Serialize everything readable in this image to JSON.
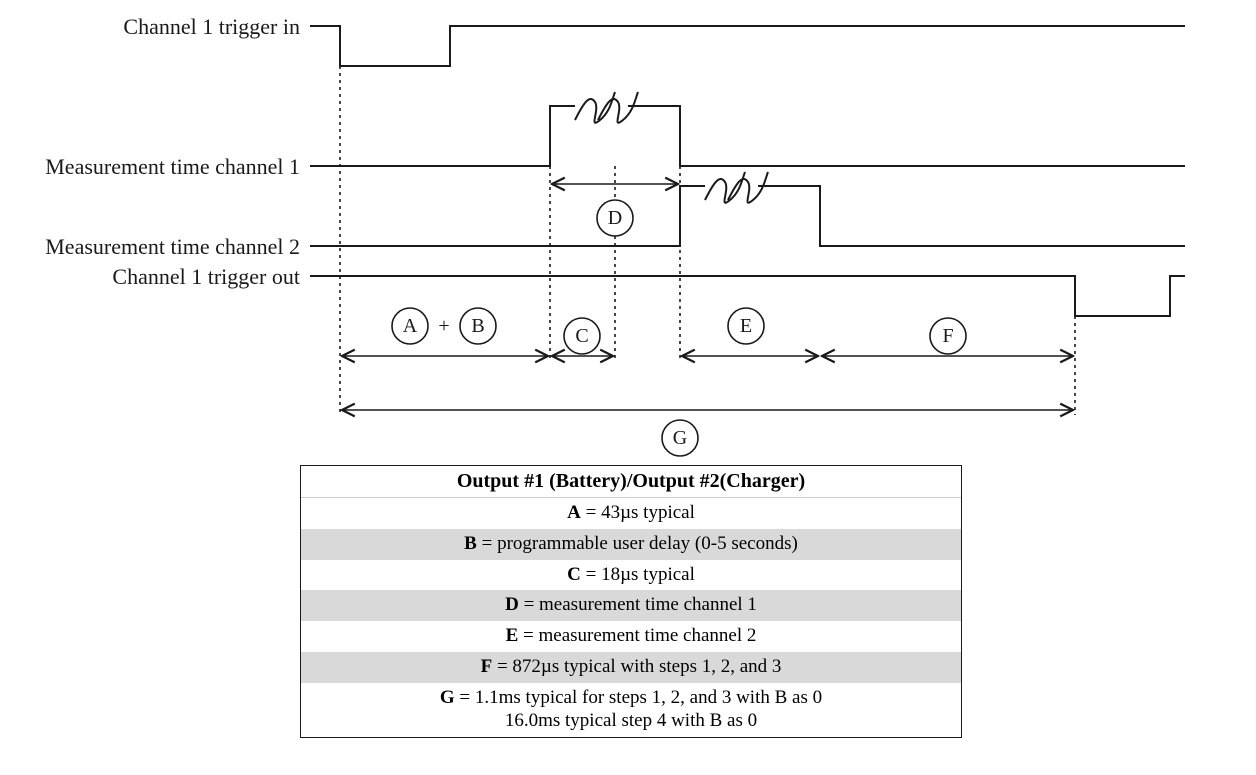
{
  "signals": {
    "trigger_in": {
      "label": "Channel 1 trigger in"
    },
    "meas_ch1": {
      "label": "Measurement time channel 1"
    },
    "meas_ch2": {
      "label": "Measurement time channel 2"
    },
    "trigger_out": {
      "label": "Channel 1 trigger out"
    }
  },
  "spans": {
    "AB_plus": "+",
    "A": "A",
    "B": "B",
    "C": "C",
    "D": "D",
    "E": "E",
    "F": "F",
    "G": "G"
  },
  "table": {
    "header": "Output #1 (Battery)/Output #2(Charger)",
    "rows": [
      {
        "key": "A",
        "text": " = 43µs typical",
        "shade": false
      },
      {
        "key": "B",
        "text": " = programmable user delay (0-5 seconds)",
        "shade": true
      },
      {
        "key": "C",
        "text": " = 18µs typical",
        "shade": false
      },
      {
        "key": "D",
        "text": " = measurement time channel 1",
        "shade": true
      },
      {
        "key": "E",
        "text": " = measurement time channel 2",
        "shade": false
      },
      {
        "key": "F",
        "text": " = 872µs typical with steps 1, 2, and 3",
        "shade": true
      },
      {
        "key": "G",
        "text": " = 1.1ms typical for steps 1, 2, and 3 with B as 0",
        "text2": "16.0ms typical step 4 with B as 0",
        "shade": false
      }
    ]
  }
}
